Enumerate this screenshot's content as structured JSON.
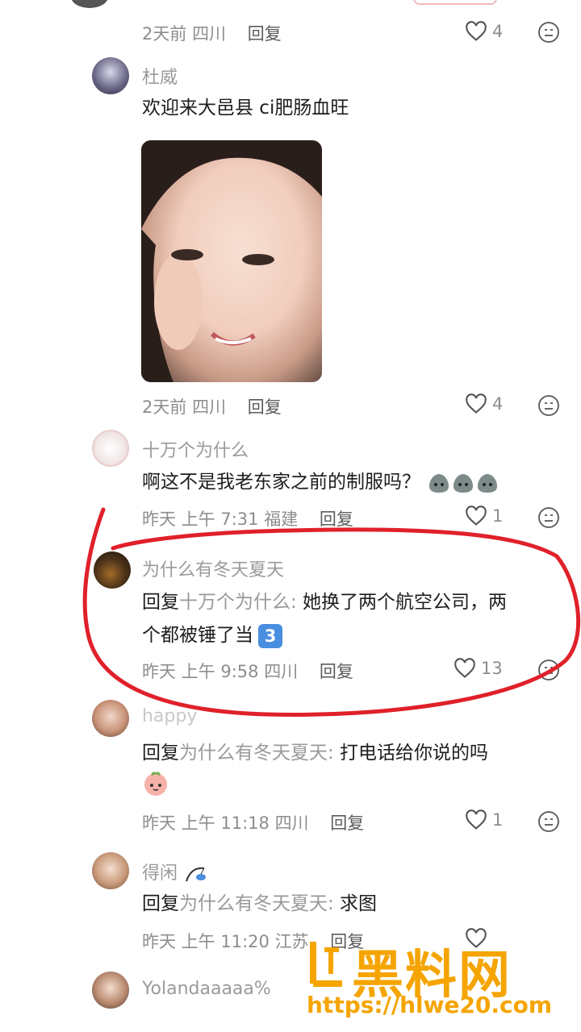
{
  "comments": [
    {
      "id": "c0",
      "meta": {
        "date": "2天前",
        "location": "四川",
        "reply": "回复"
      },
      "likes": "4"
    },
    {
      "id": "c1",
      "username": "杜威",
      "text": "欢迎来大邑县 ci肥肠血旺",
      "has_photo": true,
      "meta": {
        "date": "2天前",
        "location": "四川",
        "reply": "回复"
      },
      "likes": "4"
    },
    {
      "id": "c2",
      "username": "十万个为什么",
      "text": "啊这不是我老东家之前的制服吗？",
      "meta": {
        "date": "昨天 上午 7:31",
        "location": "福建",
        "reply": "回复"
      },
      "likes": "1"
    },
    {
      "id": "c3",
      "username": "为什么有冬天夏天",
      "reply_prefix": "回复",
      "mention": "十万个为什么:",
      "text_line1": " 她换了两个航空公司，两",
      "text_line2": "个都被锤了当",
      "meta": {
        "date": "昨天 上午 9:58",
        "location": "四川",
        "reply": "回复"
      },
      "likes": "13"
    },
    {
      "id": "c4",
      "username": "happy",
      "reply_prefix": "回复",
      "mention": "为什么有冬天夏天:",
      "text": " 打电话给你说的吗",
      "meta": {
        "date": "昨天 上午 11:18",
        "location": "四川",
        "reply": "回复"
      },
      "likes": "1"
    },
    {
      "id": "c5",
      "username": "得闲",
      "reply_prefix": "回复",
      "mention": "为什么有冬天夏天:",
      "text": " 求图",
      "meta": {
        "date": "昨天 上午 11:20",
        "location": "江苏",
        "reply": "回复"
      }
    },
    {
      "id": "c6",
      "username": "Yolandaaaaa%"
    }
  ],
  "badge": "3",
  "watermark": {
    "logo": "黑料网",
    "url": "https://hlwe20.com"
  },
  "colors": {
    "annotation": "#e0202a",
    "watermark": "#f5a400"
  }
}
